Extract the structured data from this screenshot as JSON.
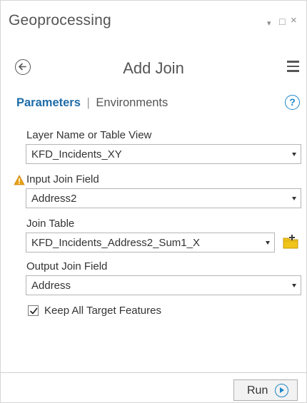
{
  "window": {
    "title": "Geoprocessing",
    "pin_glyph": "▾",
    "maximize_glyph": "□",
    "close_glyph": "×"
  },
  "tool": {
    "name": "Add Join"
  },
  "tabs": {
    "parameters": "Parameters",
    "separator": "|",
    "environments": "Environments",
    "help_glyph": "?"
  },
  "params": {
    "layer_name": {
      "label": "Layer Name or Table View",
      "value": "KFD_Incidents_XY"
    },
    "input_join_field": {
      "label": "Input Join Field",
      "value": "Address2",
      "warning": true
    },
    "join_table": {
      "label": "Join Table",
      "value": "KFD_Incidents_Address2_Sum1_X"
    },
    "output_join_field": {
      "label": "Output Join Field",
      "value": "Address"
    },
    "keep_all": {
      "label": "Keep All Target Features",
      "checked": true
    }
  },
  "footer": {
    "run_label": "Run"
  },
  "colors": {
    "accent": "#1d6ca8",
    "warning": "#e8a317",
    "folder": "#f0c419"
  }
}
